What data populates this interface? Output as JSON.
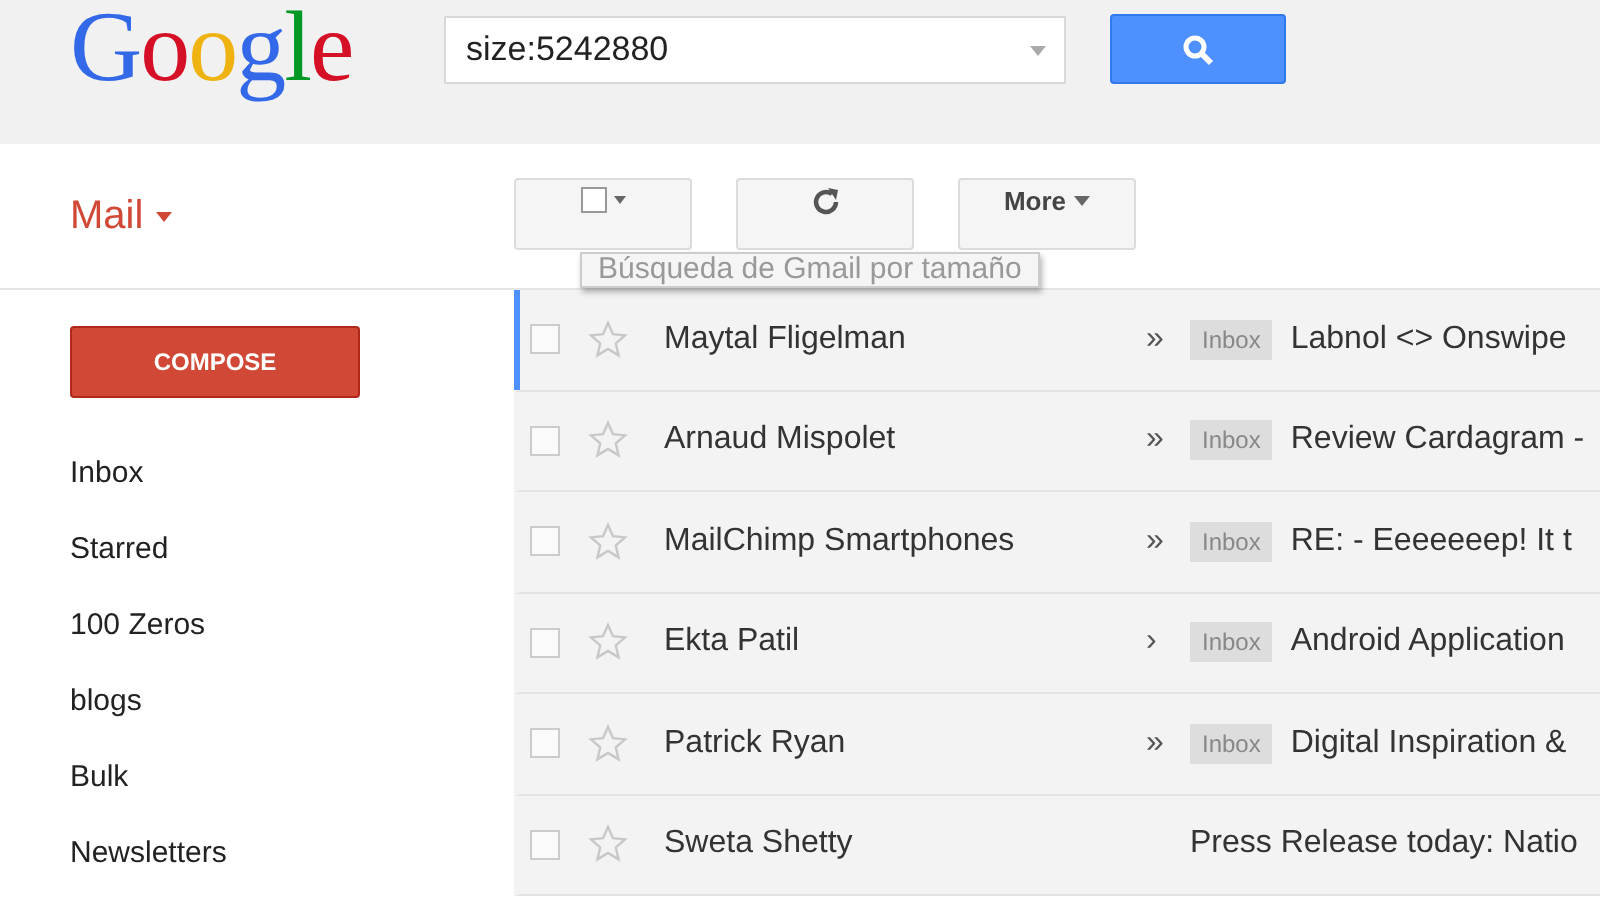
{
  "logo": {
    "letters": [
      {
        "char": "G",
        "color": "#3369e8"
      },
      {
        "char": "o",
        "color": "#d50f25"
      },
      {
        "char": "o",
        "color": "#eeb211"
      },
      {
        "char": "g",
        "color": "#3369e8"
      },
      {
        "char": "l",
        "color": "#009925"
      },
      {
        "char": "e",
        "color": "#d50f25"
      }
    ]
  },
  "search": {
    "value": "size:5242880"
  },
  "app_menu": {
    "label": "Mail"
  },
  "toolbar": {
    "buttons": [
      {
        "kind": "select"
      },
      {
        "kind": "refresh"
      },
      {
        "kind": "more",
        "label": "More"
      }
    ],
    "tooltip": "Búsqueda de Gmail por tamaño"
  },
  "compose": {
    "label": "COMPOSE"
  },
  "sidebar": {
    "items": [
      {
        "label": "Inbox"
      },
      {
        "label": "Starred"
      },
      {
        "label": "100 Zeros"
      },
      {
        "label": "blogs"
      },
      {
        "label": "Bulk"
      },
      {
        "label": "Newsletters"
      }
    ]
  },
  "messages": [
    {
      "sender": "Maytal Fligelman",
      "marker": "»",
      "label": "Inbox",
      "subject": "Labnol <> Onswipe",
      "checked": false,
      "starred": false,
      "focused": true
    },
    {
      "sender": "Arnaud Mispolet",
      "marker": "»",
      "label": "Inbox",
      "subject": "Review Cardagram -",
      "checked": false,
      "starred": false,
      "focused": false
    },
    {
      "sender": "MailChimp Smartphones",
      "marker": "»",
      "label": "Inbox",
      "subject": "RE: - Eeeeeeep! It t",
      "checked": false,
      "starred": false,
      "focused": false
    },
    {
      "sender": "Ekta Patil",
      "marker": "›",
      "label": "Inbox",
      "subject": "Android Application",
      "checked": false,
      "starred": false,
      "focused": false
    },
    {
      "sender": "Patrick Ryan",
      "marker": "»",
      "label": "Inbox",
      "subject": "Digital Inspiration &",
      "checked": false,
      "starred": false,
      "focused": false
    },
    {
      "sender": "Sweta Shetty",
      "subject": "Press Release today: Natio",
      "checked": false,
      "starred": false,
      "focused": false
    }
  ]
}
